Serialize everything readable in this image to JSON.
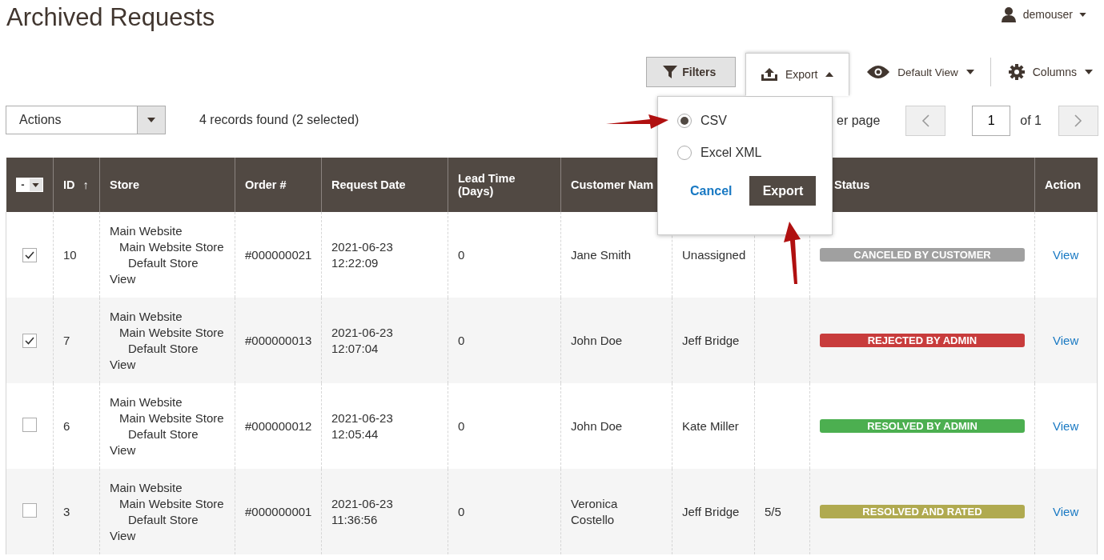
{
  "page_title": "Archived Requests",
  "user": {
    "name": "demouser"
  },
  "toolbar": {
    "filters": "Filters",
    "export": {
      "label": "Export",
      "expanded": true
    },
    "view": "Default View",
    "columns": "Columns"
  },
  "export_menu": {
    "options": [
      {
        "label": "CSV",
        "selected": true
      },
      {
        "label": "Excel XML",
        "selected": false
      }
    ],
    "cancel": "Cancel",
    "submit": "Export"
  },
  "actions": {
    "placeholder": "Actions"
  },
  "records": "4 records found (2 selected)",
  "pagination": {
    "per_page": "er page",
    "page": "1",
    "of": "of 1"
  },
  "table": {
    "mass_select": "-",
    "columns": [
      {
        "label": "ID",
        "sort_arrow": "↑"
      },
      {
        "label": "Store"
      },
      {
        "label": "Order #"
      },
      {
        "label": "Request Date"
      },
      {
        "label": "Lead Time (Days)"
      },
      {
        "label": "Customer Nam"
      },
      {
        "label": "Status"
      },
      {
        "label": "Action"
      }
    ],
    "rows": [
      {
        "checked": true,
        "id": "10",
        "store": [
          "Main Website",
          "Main Website Store",
          "Default Store",
          "View"
        ],
        "order": "#000000021",
        "date": [
          "2021-06-23",
          "12:22:09"
        ],
        "lead": "0",
        "customer": [
          "Jane Smith"
        ],
        "manager": "Unassigned",
        "status": {
          "label": "CANCELED BY CUSTOMER",
          "color": "#a0a0a0"
        },
        "action": "View"
      },
      {
        "checked": true,
        "id": "7",
        "store": [
          "Main Website",
          "Main Website Store",
          "Default Store",
          "View"
        ],
        "order": "#000000013",
        "date": [
          "2021-06-23",
          "12:07:04"
        ],
        "lead": "0",
        "customer": [
          "John Doe"
        ],
        "manager": "Jeff Bridge",
        "status": {
          "label": "REJECTED BY ADMIN",
          "color": "#c83c3c"
        },
        "action": "View"
      },
      {
        "checked": false,
        "id": "6",
        "store": [
          "Main Website",
          "Main Website Store",
          "Default Store",
          "View"
        ],
        "order": "#000000012",
        "date": [
          "2021-06-23",
          "12:05:44"
        ],
        "lead": "0",
        "customer": [
          "John Doe"
        ],
        "manager": "Kate Miller",
        "status": {
          "label": "RESOLVED BY ADMIN",
          "color": "#4caf50"
        },
        "action": "View"
      },
      {
        "checked": false,
        "id": "3",
        "store": [
          "Main Website",
          "Main Website Store",
          "Default Store",
          "View"
        ],
        "order": "#000000001",
        "date": [
          "2021-06-23",
          "11:36:56"
        ],
        "lead": "0",
        "customer": [
          "Veronica",
          "Costello"
        ],
        "manager": "Jeff Bridge",
        "rating": "5/5",
        "status": {
          "label": "RESOLVED AND RATED",
          "color": "#b0aa50"
        },
        "action": "View"
      }
    ]
  }
}
